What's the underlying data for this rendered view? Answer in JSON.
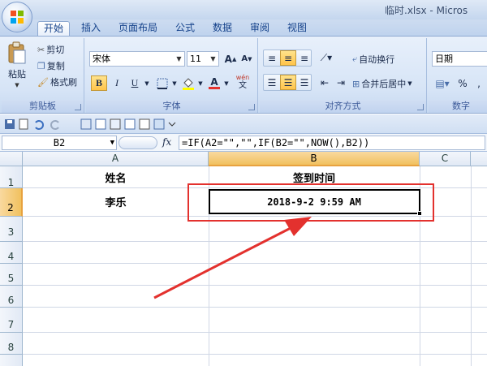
{
  "window": {
    "title": "临时.xlsx - Micros"
  },
  "tabs": [
    {
      "label": "开始",
      "active": true
    },
    {
      "label": "插入",
      "active": false
    },
    {
      "label": "页面布局",
      "active": false
    },
    {
      "label": "公式",
      "active": false
    },
    {
      "label": "数据",
      "active": false
    },
    {
      "label": "审阅",
      "active": false
    },
    {
      "label": "视图",
      "active": false
    }
  ],
  "ribbon": {
    "clipboard": {
      "label": "剪贴板",
      "paste": "粘贴",
      "cut": "剪切",
      "copy": "复制",
      "format_painter": "格式刷"
    },
    "font": {
      "label": "字体",
      "font_name": "宋体",
      "font_size": "11",
      "bold": "B",
      "italic": "I",
      "underline": "U",
      "font_color_glyph": "A",
      "phonetic": "wén",
      "grow": "A",
      "shrink": "A"
    },
    "alignment": {
      "label": "对齐方式",
      "wrap_text": "自动换行",
      "merge_center": "合并后居中"
    },
    "number": {
      "label": "数字",
      "format": "日期",
      "percent": "%",
      "comma": ","
    }
  },
  "formula_bar": {
    "name_box": "B2",
    "fx": "fx",
    "formula": "=IF(A2=\"\",\"\",IF(B2=\"\",NOW(),B2))"
  },
  "sheet": {
    "columns": [
      "A",
      "B",
      "C"
    ],
    "rows": [
      "1",
      "2",
      "3",
      "4",
      "5",
      "6",
      "7",
      "8"
    ],
    "selected_column": "B",
    "selected_row": "2",
    "cells": {
      "A1": "姓名",
      "B1": "签到时间",
      "A2": "李乐",
      "B2": "2018-9-2 9:59 AM"
    }
  },
  "colors": {
    "annotation": "#e3312e",
    "ribbon_text": "#15428b",
    "selected_header": "#f1c15f"
  }
}
